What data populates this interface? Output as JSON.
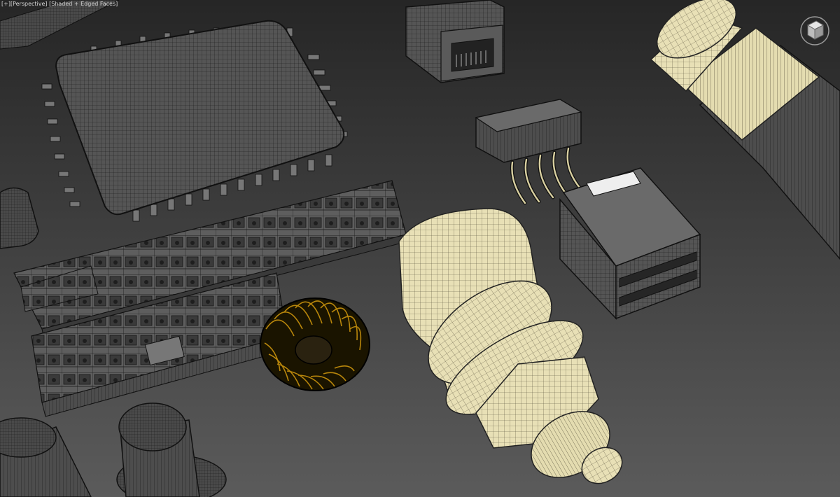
{
  "viewport": {
    "menu_label": "[+]",
    "view_label": "[Perspective]",
    "shading_label": "[Shaded + Edged Faces]"
  },
  "colors": {
    "background_top": "#2a2a2a",
    "background_bottom": "#5a5a5a",
    "gray_mesh": "#5c5c5c",
    "cream_mesh": "#e8e0b8",
    "wire": "#111111",
    "toroid_wire": "#b8860b"
  },
  "icons": {
    "viewcube": "viewcube-icon"
  }
}
